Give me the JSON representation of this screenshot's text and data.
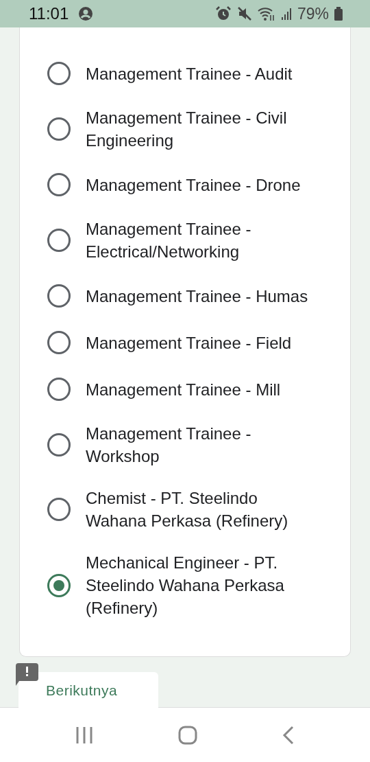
{
  "status_bar": {
    "time": "11:01",
    "battery": "79%"
  },
  "options": [
    {
      "label": "Management Trainee - Audit",
      "selected": false
    },
    {
      "label": "Management Trainee - Civil Engineering",
      "selected": false
    },
    {
      "label": "Management Trainee - Drone",
      "selected": false
    },
    {
      "label": "Management Trainee - Electrical/Networking",
      "selected": false
    },
    {
      "label": "Management Trainee - Humas",
      "selected": false
    },
    {
      "label": "Management Trainee - Field",
      "selected": false
    },
    {
      "label": "Management Trainee - Mill",
      "selected": false
    },
    {
      "label": "Management Trainee - Workshop",
      "selected": false
    },
    {
      "label": "Chemist - PT. Steelindo Wahana Perkasa (Refinery)",
      "selected": false
    },
    {
      "label": "Mechanical Engineer - PT. Steelindo Wahana Perkasa (Refinery)",
      "selected": true
    }
  ],
  "next_button": "Berikutnya"
}
